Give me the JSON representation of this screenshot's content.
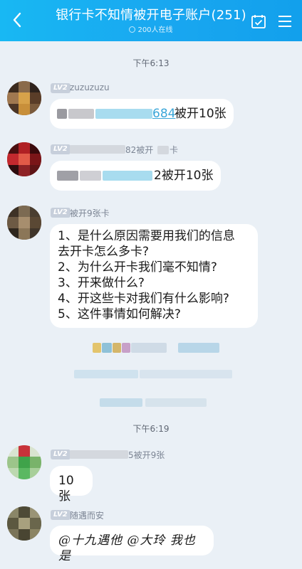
{
  "header": {
    "title": "银行卡不知情被开电子账户(251)",
    "online": "200人在线",
    "back_icon": "chevron-left-icon",
    "calendar_icon": "calendar-check-icon",
    "menu_icon": "menu-icon"
  },
  "messages": {
    "t1": "下午6:13",
    "m1": {
      "level": "LV2",
      "nick": "zuzuzuzu",
      "text_tail": "684",
      "text_main": "被开10张"
    },
    "m2": {
      "level": "LV2",
      "nick_tail": "82被开",
      "nick_tail2": "卡",
      "text_tail": "2被开10张"
    },
    "m3": {
      "level": "LV2",
      "nick": "被开9张卡",
      "lines": [
        "1、是什么原因需要用我们的信息",
        "去开卡怎么多卡?",
        "2、为什么开卡我们毫不知情?",
        "3、开来做什么?",
        "4、开这些卡对我们有什么影响?",
        "5、这件事情如何解决?"
      ]
    },
    "t2": "下午6:19",
    "m4": {
      "level": "LV2",
      "nick_tail": "5被开9张",
      "text": "10张"
    },
    "m5": {
      "level": "LV2",
      "nick": "随遇而安",
      "text": "@十九遇他 @大玲 我也是"
    }
  },
  "colors": {
    "header_start": "#18b8f3",
    "header_end": "#12a0ec",
    "background": "#eaf0f6",
    "bubble": "#ffffff",
    "level_badge": "#c7cfdb",
    "link_blue": "#3aa6d9"
  }
}
